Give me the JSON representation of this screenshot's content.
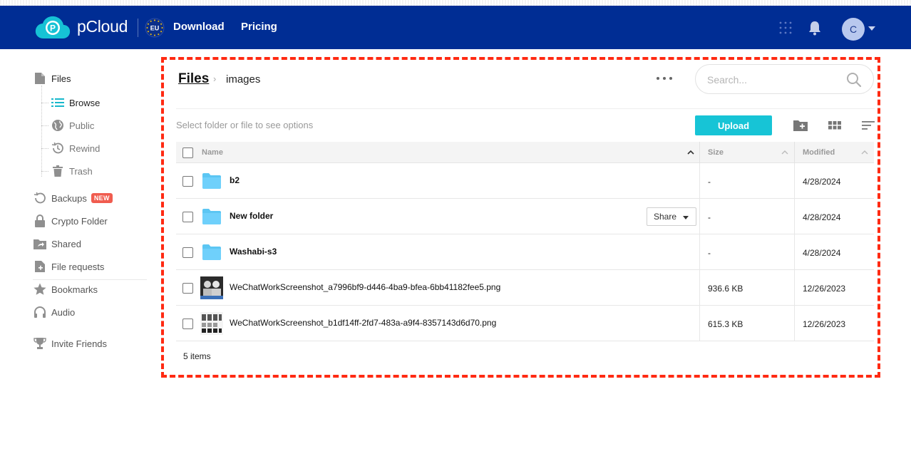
{
  "header": {
    "brand": "pCloud",
    "region_badge": "EU",
    "nav": [
      {
        "label": "Download"
      },
      {
        "label": "Pricing"
      }
    ],
    "avatar_initial": "C",
    "colors": {
      "header_bg": "#002d94",
      "accent": "#17c4d6"
    }
  },
  "sidebar": {
    "files": "Files",
    "sub": [
      {
        "label": "Browse",
        "icon": "list-icon"
      },
      {
        "label": "Public",
        "icon": "globe-icon"
      },
      {
        "label": "Rewind",
        "icon": "history-icon"
      },
      {
        "label": "Trash",
        "icon": "trash-icon"
      }
    ],
    "items": [
      {
        "label": "Backups",
        "icon": "backup-icon",
        "badge": "NEW"
      },
      {
        "label": "Crypto Folder",
        "icon": "lock-icon"
      },
      {
        "label": "Shared",
        "icon": "shared-folder-icon"
      },
      {
        "label": "File requests",
        "icon": "file-request-icon"
      },
      {
        "label": "Bookmarks",
        "icon": "star-icon"
      },
      {
        "label": "Audio",
        "icon": "headphones-icon"
      }
    ],
    "invite": "Invite Friends"
  },
  "main": {
    "breadcrumb": {
      "root": "Files",
      "separator": "›",
      "current": "images"
    },
    "search_placeholder": "Search...",
    "hint": "Select folder or file to see options",
    "upload_label": "Upload",
    "table": {
      "columns": {
        "name": "Name",
        "size": "Size",
        "modified": "Modified"
      },
      "rows": [
        {
          "type": "folder",
          "name": "b2",
          "size": "-",
          "modified": "4/28/2024"
        },
        {
          "type": "folder",
          "name": "New folder",
          "size": "-",
          "modified": "4/28/2024",
          "share_label": "Share"
        },
        {
          "type": "folder",
          "name": "Washabi-s3",
          "size": "-",
          "modified": "4/28/2024"
        },
        {
          "type": "image",
          "name": "WeChatWorkScreenshot_a7996bf9-d446-4ba9-bfea-6bb41182fee5.png",
          "size": "936.6 KB",
          "modified": "12/26/2023"
        },
        {
          "type": "image",
          "name": "WeChatWorkScreenshot_b1df14ff-2fd7-483a-a9f4-8357143d6d70.png",
          "size": "615.3 KB",
          "modified": "12/26/2023"
        }
      ]
    },
    "item_count": "5 items"
  }
}
